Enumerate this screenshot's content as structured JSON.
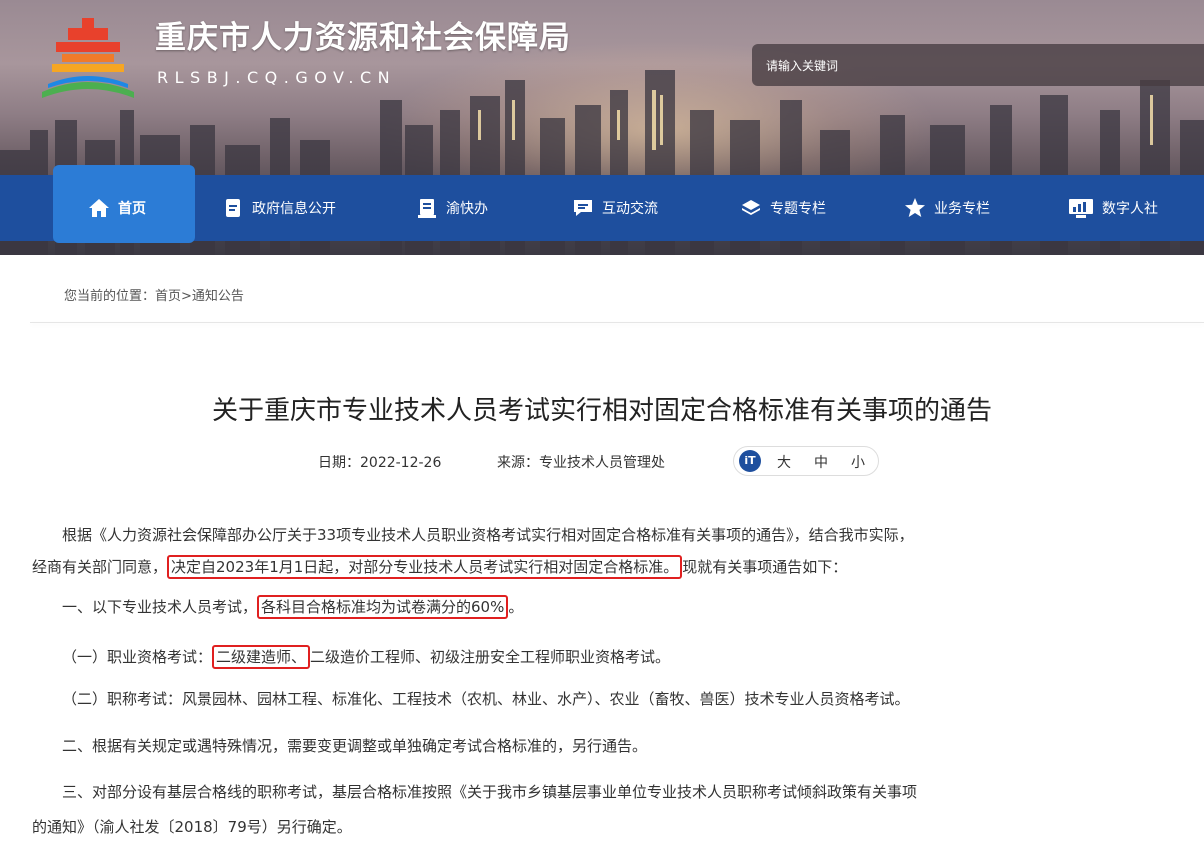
{
  "header": {
    "site_title": "重庆市人力资源和社会保障局",
    "site_domain": "RLSBJ.CQ.GOV.CN",
    "search_placeholder": "请输入关键词"
  },
  "nav": {
    "items": [
      {
        "label": "首页",
        "icon": "home-icon"
      },
      {
        "label": "政府信息公开",
        "icon": "document-icon"
      },
      {
        "label": "渝快办",
        "icon": "clipboard-icon"
      },
      {
        "label": "互动交流",
        "icon": "chat-icon"
      },
      {
        "label": "专题专栏",
        "icon": "layers-icon"
      },
      {
        "label": "业务专栏",
        "icon": "star-icon"
      },
      {
        "label": "数字人社",
        "icon": "monitor-chart-icon"
      }
    ]
  },
  "breadcrumb": "您当前的位置：首页>通知公告",
  "article": {
    "title": "关于重庆市专业技术人员考试实行相对固定合格标准有关事项的通告",
    "date": "日期：2022-12-26",
    "source": "来源：专业技术人员管理处",
    "font_size_options": [
      "大",
      "中",
      "小"
    ],
    "p1_line1": "根据《人力资源社会保障部办公厅关于33项专业技术人员职业资格考试实行相对固定合格标准有关事项的通告》，结合我市实际，",
    "p1_line2_pre": "经商有关部门同意，",
    "p1_line2_hl": "决定自2023年1月1日起，对部分专业技术人员考试实行相对固定合格标准。",
    "p1_line2_post": "现就有关事项通告如下：",
    "p2_pre": "一、以下专业技术人员考试，",
    "p2_hl": "各科目合格标准均为试卷满分的60%",
    "p2_post": "。",
    "p3_pre": "（一）职业资格考试：",
    "p3_hl": "二级建造师、",
    "p3_post": "二级造价工程师、初级注册安全工程师职业资格考试。",
    "p4": "（二）职称考试：风景园林、园林工程、标准化、工程技术（农机、林业、水产）、农业（畜牧、兽医）技术专业人员资格考试。",
    "p5": "二、根据有关规定或遇特殊情况，需要变更调整或单独确定考试合格标准的，另行通告。",
    "p6_line1": "三、对部分设有基层合格线的职称考试，基层合格标准按照《关于我市乡镇基层事业单位专业技术人员职称考试倾斜政策有关事项",
    "p6_line2": "的通知》（渝人社发〔2018〕79号）另行确定。"
  },
  "colors": {
    "nav_bg": "#1e4f9e",
    "nav_active": "#2c7cd6",
    "highlight_border": "#e02020"
  }
}
